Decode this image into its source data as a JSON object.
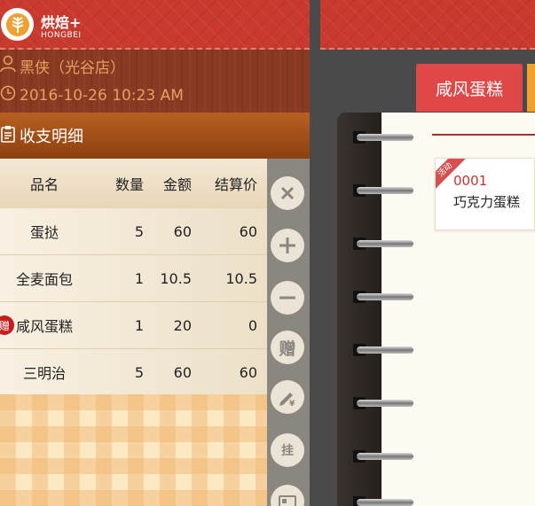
{
  "app": {
    "title": "烘焙+",
    "subtitle": "HONGBEI"
  },
  "info": {
    "operator": "黑侠（光谷店）",
    "datetime": "2016-10-26 10:23 AM"
  },
  "section": {
    "title": "收支明细"
  },
  "table": {
    "headers": [
      "品名",
      "数量",
      "金额",
      "结算价"
    ],
    "rows": [
      {
        "name": "蛋挞",
        "qty": "5",
        "amount": "60",
        "settle": "60",
        "gift": ""
      },
      {
        "name": "全麦面包",
        "qty": "1",
        "amount": "10.5",
        "settle": "10.5",
        "gift": ""
      },
      {
        "name": "咸风蛋糕",
        "qty": "1",
        "amount": "20",
        "settle": "0",
        "gift": "赠"
      },
      {
        "name": "三明治",
        "qty": "5",
        "amount": "60",
        "settle": "60",
        "gift": ""
      }
    ]
  },
  "actions": {
    "gift_label": "赠",
    "hang_label": "挂"
  },
  "category_tab": {
    "label": "咸风蛋糕"
  },
  "product_card": {
    "badge": "活动",
    "code": "0001",
    "name": "巧克力蛋糕"
  },
  "colors": {
    "header_red": "#c8392e",
    "tab_red": "#e04848",
    "accent_orange": "#f0a030",
    "code_red": "#d03030"
  }
}
